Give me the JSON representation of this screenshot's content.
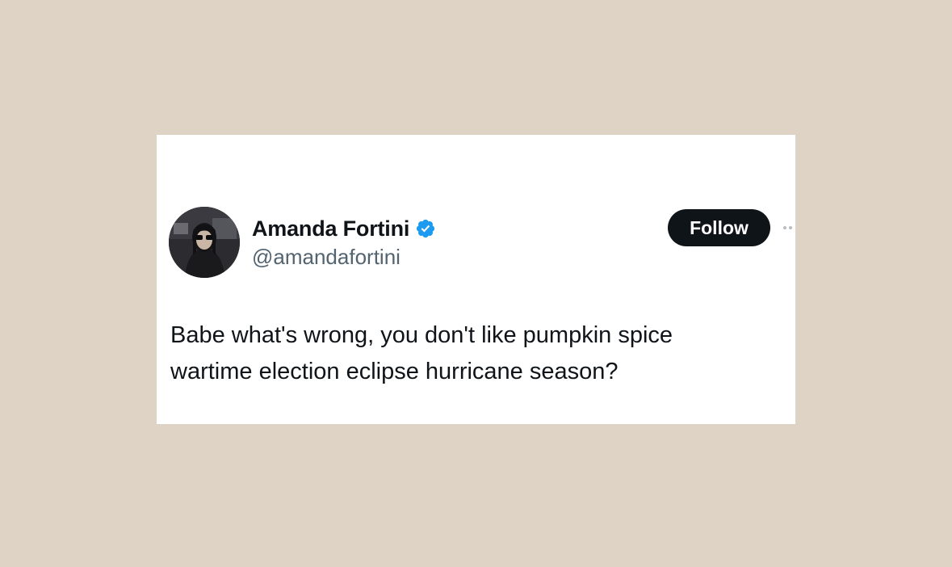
{
  "background_color": "#ded3c4",
  "tweet": {
    "author": {
      "display_name": "Amanda Fortini",
      "handle": "@amandafortini",
      "verified": true,
      "verified_icon": "verified-badge-icon",
      "verified_color": "#1d9bf0"
    },
    "follow_label": "Follow",
    "more_icon": "more-options-icon",
    "text_lines": [
      "Babe what's wrong, you don't like pumpkin spice",
      "wartime election eclipse hurricane season?"
    ]
  },
  "colors": {
    "card": "#ffffff",
    "text_primary": "#0f1419",
    "text_secondary": "#536471",
    "button": "#0f1419"
  }
}
